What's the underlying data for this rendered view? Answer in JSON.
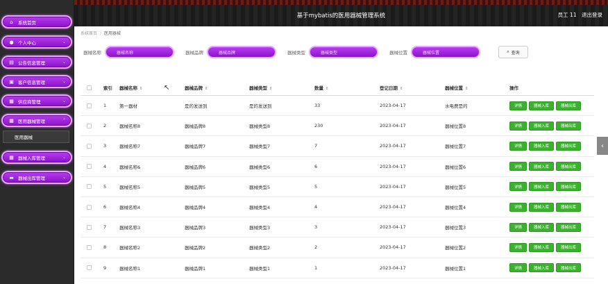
{
  "header": {
    "title": "基于mybatis的医用器械管理系统",
    "user": "员工 11",
    "logout": "退出登录"
  },
  "sidebar": {
    "items": [
      {
        "label": "系统首页",
        "icon": "home-icon",
        "glyph": "⌂",
        "arrow": ""
      },
      {
        "label": "个人中心",
        "icon": "user-icon",
        "glyph": "●",
        "arrow": "⌄"
      },
      {
        "label": "公告信息管理",
        "icon": "doc-icon",
        "glyph": "▤",
        "arrow": "⌄"
      },
      {
        "label": "客户信息管理",
        "icon": "store-icon",
        "glyph": "▣",
        "arrow": "⌄"
      },
      {
        "label": "供应商管理",
        "icon": "grid-icon",
        "glyph": "▦",
        "arrow": "⌄"
      },
      {
        "label": "医用器械管理",
        "icon": "grid-icon",
        "glyph": "▦",
        "arrow": "⌃"
      },
      {
        "label": "器械入库管理",
        "icon": "grid-icon",
        "glyph": "▦",
        "arrow": "⌄"
      },
      {
        "label": "器械出库管理",
        "icon": "chat-icon",
        "glyph": "▬",
        "arrow": "⌄"
      }
    ],
    "submenu": "医用器械"
  },
  "breadcrumb": {
    "home": "系统首页",
    "sep": "/",
    "current": "医用器械"
  },
  "search": {
    "fields": [
      {
        "label": "器械名称",
        "placeholder": "器械名称"
      },
      {
        "label": "器械品牌",
        "placeholder": "器械品牌"
      },
      {
        "label": "器械类型",
        "placeholder": "器械类型"
      },
      {
        "label": "器械位置",
        "placeholder": "器械位置"
      }
    ],
    "button": "查询"
  },
  "table": {
    "headers": {
      "index": "索引",
      "name": "器械名称",
      "brand": "器械品牌",
      "type": "器械类型",
      "qty": "数量",
      "date": "登记日期",
      "loc": "器械位置",
      "ops": "操作"
    },
    "sort_icon": "⇕",
    "rows": [
      {
        "index": "1",
        "name": "第一器材",
        "brand": "是的发送到",
        "type": "是的发送到",
        "qty": "33",
        "date": "2023-04-17",
        "loc": "水电费是的"
      },
      {
        "index": "2",
        "name": "器械名称8",
        "brand": "器械品牌8",
        "type": "器械类型8",
        "qty": "230",
        "date": "2023-04-17",
        "loc": "器械位置8"
      },
      {
        "index": "3",
        "name": "器械名称7",
        "brand": "器械品牌7",
        "type": "器械类型7",
        "qty": "7",
        "date": "2023-04-17",
        "loc": "器械位置7"
      },
      {
        "index": "4",
        "name": "器械名称6",
        "brand": "器械品牌6",
        "type": "器械类型6",
        "qty": "6",
        "date": "2023-04-17",
        "loc": "器械位置6"
      },
      {
        "index": "5",
        "name": "器械名称5",
        "brand": "器械品牌5",
        "type": "器械类型5",
        "qty": "5",
        "date": "2023-04-17",
        "loc": "器械位置5"
      },
      {
        "index": "6",
        "name": "器械名称4",
        "brand": "器械品牌4",
        "type": "器械类型4",
        "qty": "4",
        "date": "2023-04-17",
        "loc": "器械位置4"
      },
      {
        "index": "7",
        "name": "器械名称3",
        "brand": "器械品牌3",
        "type": "器械类型3",
        "qty": "3",
        "date": "2023-04-17",
        "loc": "器械位置3"
      },
      {
        "index": "8",
        "name": "器械名称2",
        "brand": "器械品牌2",
        "type": "器械类型2",
        "qty": "2",
        "date": "2023-04-17",
        "loc": "器械位置2"
      },
      {
        "index": "9",
        "name": "器械名称1",
        "brand": "器械品牌1",
        "type": "器械类型1",
        "qty": "1",
        "date": "2023-04-17",
        "loc": "器械位置1"
      }
    ],
    "actions": [
      "详情",
      "器械入库",
      "器械出库"
    ]
  },
  "colors": {
    "accent": "#9b22d6",
    "button_green": "#3cb02f",
    "sidebar_bg": "#2b2b2b"
  }
}
